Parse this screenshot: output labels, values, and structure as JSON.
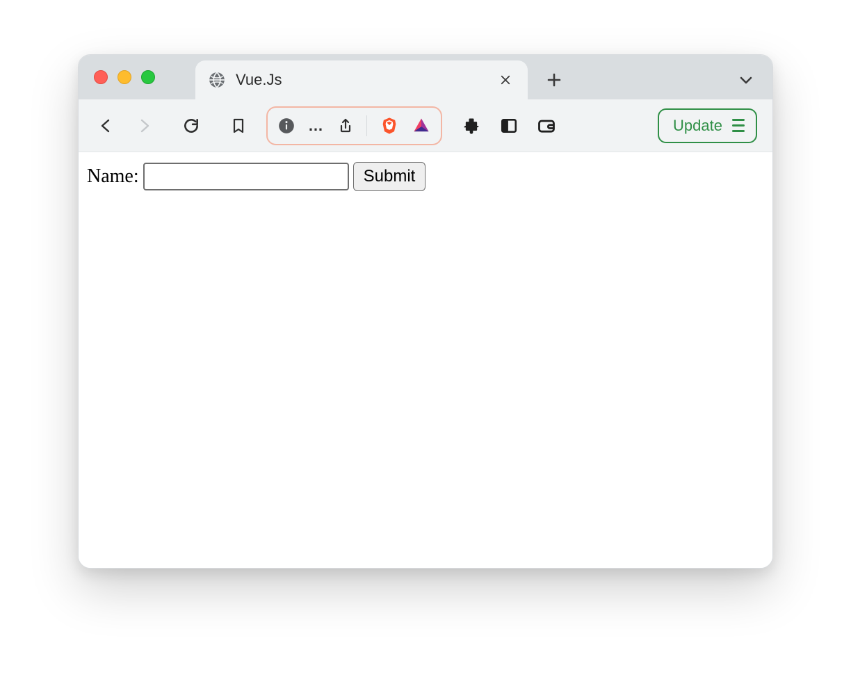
{
  "browser": {
    "tab": {
      "title": "Vue.Js"
    },
    "toolbar": {
      "update_label": "Update"
    }
  },
  "page": {
    "form": {
      "name_label": "Name:",
      "name_value": "",
      "submit_label": "Submit"
    }
  },
  "colors": {
    "update_border": "#2f8f46",
    "address_border": "#f3b6a4"
  }
}
